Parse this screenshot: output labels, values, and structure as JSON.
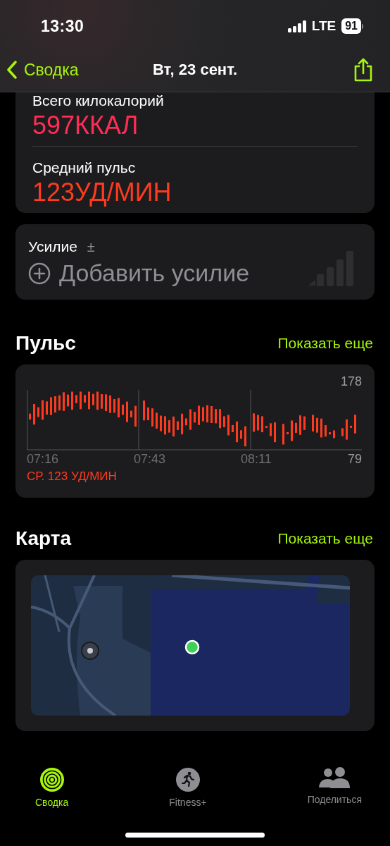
{
  "status_bar": {
    "time": "13:30",
    "network": "LTE",
    "battery": "91"
  },
  "nav": {
    "back": "Сводка",
    "title": "Вт, 23 сент."
  },
  "metrics": [
    {
      "label": "Всего килокалорий",
      "value": "597ККАЛ",
      "color": "#ff2d55"
    },
    {
      "label": "Средний пульс",
      "value": "123УД/МИН",
      "color": "#ff3b1f"
    }
  ],
  "effort": {
    "label": "Усилие",
    "badge": "±",
    "action": "Добавить усилие"
  },
  "heart_rate": {
    "title": "Пульс",
    "more": "Показать еще",
    "max": "178",
    "min": "79",
    "times": [
      "07:16",
      "07:43",
      "08:11"
    ],
    "average": "СР. 123 УД/МИН"
  },
  "map": {
    "title": "Карта",
    "more": "Показать еще"
  },
  "tabs": [
    {
      "label": "Сводка",
      "selected": true,
      "kind": "rings"
    },
    {
      "label": "Fitness+",
      "selected": false,
      "kind": "runner"
    },
    {
      "label": "Поделиться",
      "selected": false,
      "kind": "people"
    }
  ]
}
